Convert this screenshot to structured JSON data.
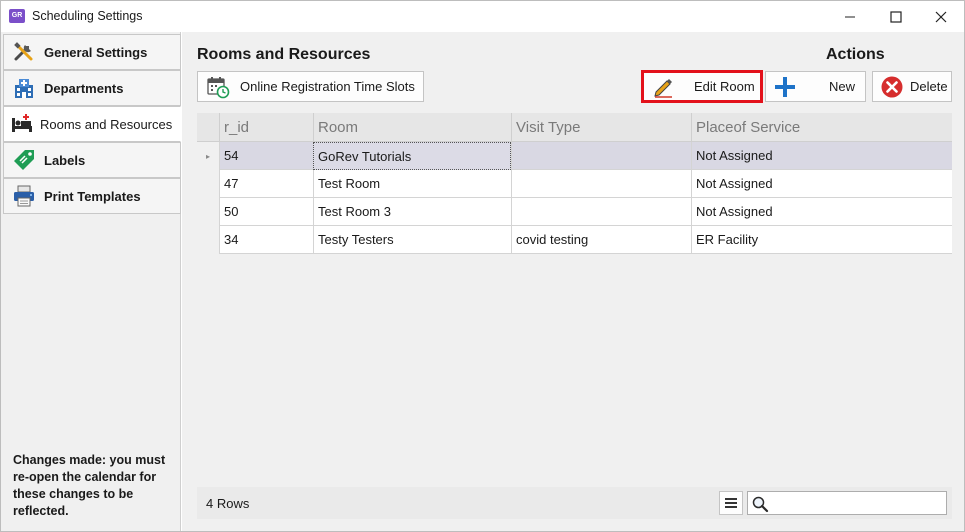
{
  "window": {
    "title": "Scheduling Settings",
    "app_icon_text": "GoRev",
    "controls": [
      "minimize-icon",
      "maximize-icon",
      "close-icon"
    ]
  },
  "sidebar": {
    "items": [
      {
        "label": "General Settings",
        "icon": "tools-icon",
        "active": false
      },
      {
        "label": "Departments",
        "icon": "hospital-building-icon",
        "active": false
      },
      {
        "label": "Rooms and Resources",
        "icon": "bed-icon",
        "active": true
      },
      {
        "label": "Labels",
        "icon": "tag-icon",
        "active": false
      },
      {
        "label": "Print Templates",
        "icon": "printer-icon",
        "active": false
      }
    ],
    "note": "Changes made: you must re-open the calendar for these changes to be reflected."
  },
  "main": {
    "section_title": "Rooms and Resources",
    "actions_title": "Actions",
    "buttons": {
      "slots": "Online Registration Time Slots",
      "edit": "Edit Room",
      "new": "New",
      "delete": "Delete"
    },
    "highlight_color": "#e3111b"
  },
  "grid": {
    "columns": [
      "r_id",
      "Room",
      "Visit Type",
      "Placeof Service"
    ],
    "rows": [
      {
        "r_id": "54",
        "room": "GoRev Tutorials",
        "visit_type": "",
        "place": "Not Assigned",
        "selected": true
      },
      {
        "r_id": "47",
        "room": "Test Room",
        "visit_type": "",
        "place": "Not Assigned",
        "selected": false
      },
      {
        "r_id": "50",
        "room": "Test Room 3",
        "visit_type": "",
        "place": "Not Assigned",
        "selected": false
      },
      {
        "r_id": "34",
        "room": "Testy Testers",
        "visit_type": "covid testing",
        "place": "ER Facility",
        "selected": false
      }
    ],
    "selected_row_indicator": "▸",
    "row_count_label": "4 Rows",
    "search_placeholder": ""
  }
}
